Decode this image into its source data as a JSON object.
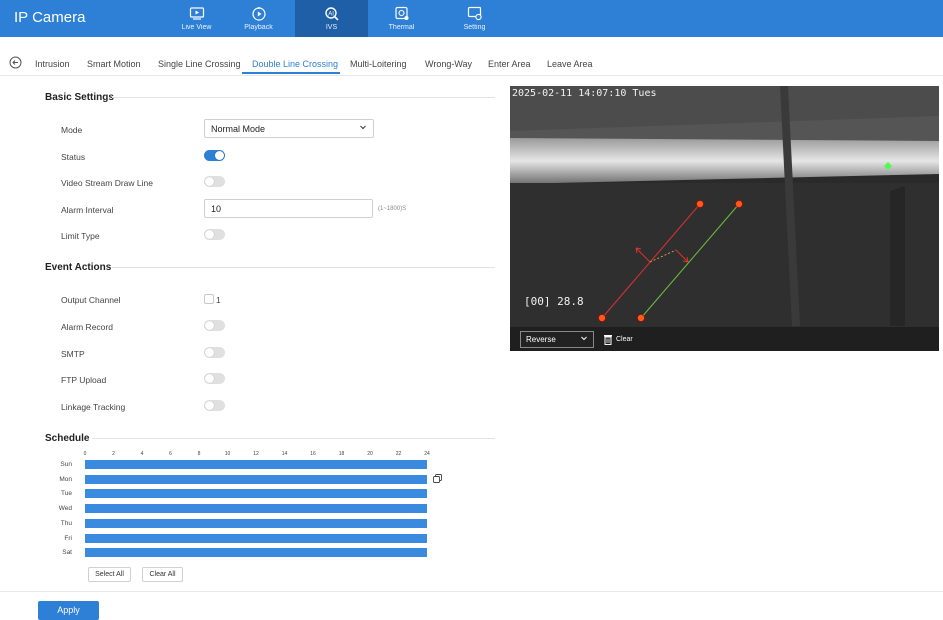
{
  "app": {
    "title": "IP Camera"
  },
  "nav": [
    {
      "label": "Live View",
      "icon": "live-view-icon",
      "active": false
    },
    {
      "label": "Playback",
      "icon": "playback-icon",
      "active": false
    },
    {
      "label": "IVS",
      "icon": "ivs-icon",
      "active": true
    },
    {
      "label": "Thermal",
      "icon": "thermal-icon",
      "active": false
    },
    {
      "label": "Setting",
      "icon": "setting-icon",
      "active": false
    }
  ],
  "tabs": [
    {
      "label": "Intrusion"
    },
    {
      "label": "Smart Motion"
    },
    {
      "label": "Single Line Crossing"
    },
    {
      "label": "Double Line Crossing",
      "active": true
    },
    {
      "label": "Multi-Loitering"
    },
    {
      "label": "Wrong-Way"
    },
    {
      "label": "Enter Area"
    },
    {
      "label": "Leave Area"
    }
  ],
  "basic": {
    "title": "Basic Settings",
    "mode_label": "Mode",
    "mode_value": "Normal Mode",
    "status_label": "Status",
    "status_on": true,
    "draw_line_label": "Video Stream Draw Line",
    "draw_line_on": false,
    "alarm_interval_label": "Alarm Interval",
    "alarm_interval_value": "10",
    "alarm_interval_hint": "(1~1800)S",
    "limit_type_label": "Limit Type",
    "limit_type_on": false
  },
  "events": {
    "title": "Event Actions",
    "output_channel_label": "Output Channel",
    "output_channel_value": "1",
    "output_channel_checked": false,
    "alarm_record_label": "Alarm Record",
    "alarm_record_on": false,
    "smtp_label": "SMTP",
    "smtp_on": false,
    "ftp_label": "FTP Upload",
    "ftp_on": false,
    "linkage_label": "Linkage Tracking",
    "linkage_on": false
  },
  "schedule": {
    "title": "Schedule",
    "hours": [
      "0",
      "2",
      "4",
      "6",
      "8",
      "10",
      "12",
      "14",
      "16",
      "18",
      "20",
      "22",
      "24"
    ],
    "days": [
      "Sun",
      "Mon",
      "Tue",
      "Wed",
      "Thu",
      "Fri",
      "Sat"
    ],
    "select_all": "Select All",
    "clear_all": "Clear All"
  },
  "video": {
    "timestamp": "2025-02-11 14:07:10 Tues",
    "temperature": "[00] 28.8",
    "direction_value": "Reverse",
    "clear_label": "Clear"
  },
  "apply_label": "Apply",
  "colors": {
    "accent": "#2e7fd6",
    "nav_active": "#1f5fa8",
    "line_red": "#e03030",
    "line_green": "#6cc040",
    "marker": "#ff5a1a"
  }
}
